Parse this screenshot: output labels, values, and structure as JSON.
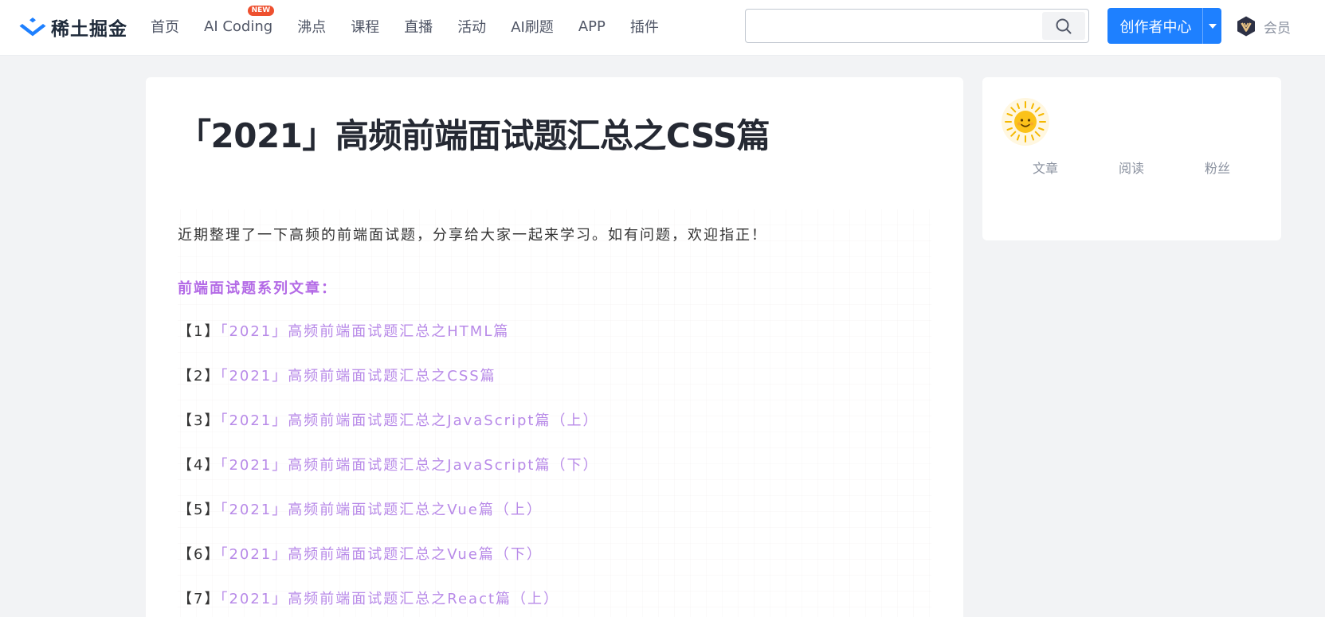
{
  "header": {
    "logo_text": "稀土掘金",
    "nav": [
      {
        "label": "首页"
      },
      {
        "label": "AI Coding",
        "badge": "NEW"
      },
      {
        "label": "沸点"
      },
      {
        "label": "课程"
      },
      {
        "label": "直播"
      },
      {
        "label": "活动"
      },
      {
        "label": "AI刷题"
      },
      {
        "label": "APP"
      },
      {
        "label": "插件"
      }
    ],
    "search": {
      "value": "",
      "placeholder": "",
      "icon": "search-icon"
    },
    "creator_button": "创作者中心",
    "vip_label": "会员",
    "accent": "#1e80ff"
  },
  "article": {
    "title": "「2021」高频前端面试题汇总之CSS篇",
    "intro": "近期整理了一下高频的前端面试题，分享给大家一起来学习。如有问题，欢迎指正！",
    "series_heading": "前端面试题系列文章：",
    "links": [
      {
        "num": "【1】",
        "text": "「2021」高频前端面试题汇总之HTML篇"
      },
      {
        "num": "【2】",
        "text": "「2021」高频前端面试题汇总之CSS篇"
      },
      {
        "num": "【3】",
        "text": "「2021」高频前端面试题汇总之JavaScript篇（上）"
      },
      {
        "num": "【4】",
        "text": "「2021」高频前端面试题汇总之JavaScript篇（下）"
      },
      {
        "num": "【5】",
        "text": "「2021」高频前端面试题汇总之Vue篇（上）"
      },
      {
        "num": "【6】",
        "text": "「2021」高频前端面试题汇总之Vue篇（下）"
      },
      {
        "num": "【7】",
        "text": "「2021」高频前端面试题汇总之React篇（上）"
      }
    ],
    "link_color": "#b88ae8"
  },
  "author": {
    "avatar_icon": "sun-avatar-icon",
    "stats": [
      {
        "label": "文章"
      },
      {
        "label": "阅读"
      },
      {
        "label": "粉丝"
      }
    ]
  }
}
